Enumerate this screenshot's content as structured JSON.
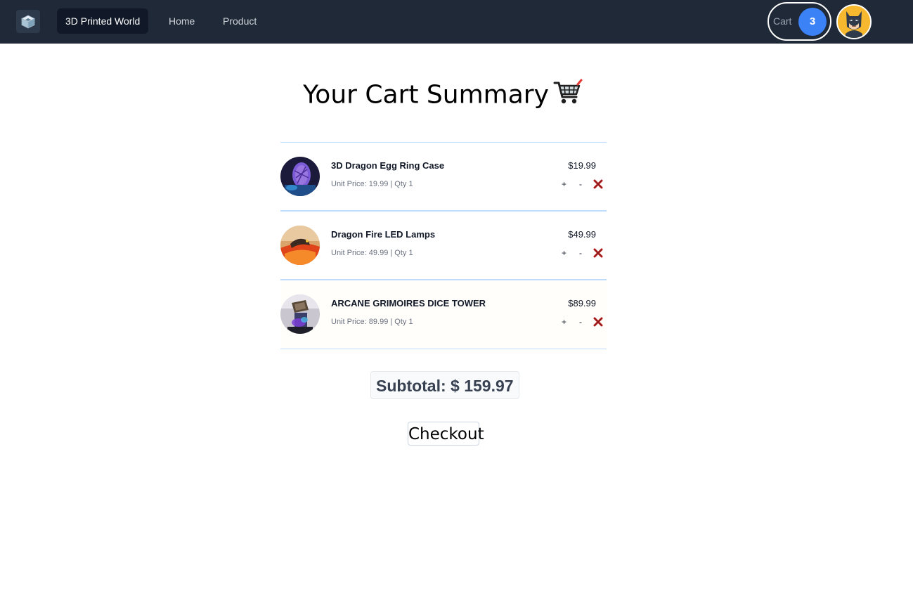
{
  "nav": {
    "brand": "3D Printed World",
    "links": [
      "Home",
      "Product"
    ],
    "cart_label": "Cart",
    "cart_count": "3"
  },
  "page": {
    "title": "Your Cart Summary"
  },
  "items": [
    {
      "name": "3D Dragon Egg Ring Case",
      "meta": "Unit Price: 19.99 | Qty 1",
      "price": "$19.99",
      "plus": "+",
      "minus": "-"
    },
    {
      "name": "Dragon Fire LED Lamps",
      "meta": "Unit Price: 49.99 | Qty 1",
      "price": "$49.99",
      "plus": "+",
      "minus": "-"
    },
    {
      "name": "ARCANE GRIMOIRES DICE TOWER",
      "meta": "Unit Price: 89.99 | Qty 1",
      "price": "$89.99",
      "plus": "+",
      "minus": "-"
    }
  ],
  "summary": {
    "subtotal": "Subtotal: $ 159.97",
    "checkout": "Checkout"
  },
  "colors": {
    "navbar": "#1f2937",
    "accent": "#3b82f6",
    "divider": "#bfdbfe",
    "remove": "#b91c1c"
  }
}
